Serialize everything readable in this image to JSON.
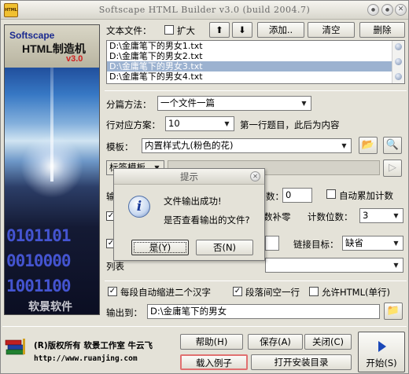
{
  "window": {
    "title": "Softscape HTML Builder v3.0 (build 2004.7)",
    "app_icon": "HTML",
    "min_glyph": "●",
    "max_glyph": "●",
    "close_glyph": "✕"
  },
  "banner": {
    "line1": "Softscape",
    "line2": "HTML制造机",
    "line3": "v3.0",
    "binary": [
      "0101101",
      "0010000",
      "1001100"
    ],
    "brand": "软景软件"
  },
  "files": {
    "label": "文本文件：",
    "expand_label": "扩大",
    "expand_checked": false,
    "up_glyph": "⬆",
    "down_glyph": "⬇",
    "add_label": "添加..",
    "clear_label": "清空",
    "delete_label": "删除",
    "items": [
      "D:\\金庸笔下的男女1.txt",
      "D:\\金庸笔下的男女2.txt",
      "D:\\金庸笔下的男女3.txt",
      "D:\\金庸笔下的男女4.txt"
    ],
    "selected_index": 2
  },
  "split": {
    "label": "分篇方法：",
    "value": "一个文件一篇"
  },
  "row_plan": {
    "label": "行对应方案：",
    "value": "10",
    "note": "第一行题目，此后为内容"
  },
  "template": {
    "label": "模板：",
    "value": "内置样式九(粉色的花)",
    "open_icon": "📂",
    "search_icon": "🔍"
  },
  "tags": {
    "select_value": "标签模板"
  },
  "counters": {
    "partial_label": "数：",
    "value": "0",
    "auto_accum_label": "自动累加计数",
    "auto_accum_checked": false,
    "pad_zero_label": "数补零",
    "digits_label": "计数位数：",
    "digits_value": "3"
  },
  "link_target": {
    "label": "链接目标：",
    "value": "缺省"
  },
  "list_partial": {
    "label": "列表"
  },
  "options": {
    "indent_label": "每段自动缩进二个汉字",
    "indent_checked": true,
    "blank_line_label": "段落间空一行",
    "blank_line_checked": true,
    "allow_html_label": "允许HTML(单行)",
    "allow_html_checked": false
  },
  "output": {
    "label": "输出到：",
    "value": "D:\\金庸笔下的男女"
  },
  "footer": {
    "copyright": "(R)版权所有 软景工作室 牛云飞",
    "url": "http://www.ruanjing.com",
    "help_label": "帮助(H)",
    "save_label": "保存(A)",
    "close_label": "关闭(C)",
    "load_example_label": "载入例子",
    "open_install_label": "打开安装目录",
    "start_label": "开始(S)"
  },
  "dialog": {
    "title": "提示",
    "line1": "文件输出成功!",
    "line2": "是否查看输出的文件?",
    "yes_label": "是(Y)",
    "no_label": "否(N)",
    "icon_glyph": "i"
  },
  "colors": {
    "accent_selection": "#9cb2d0",
    "start_arrow": "#1a48b8",
    "load_example_border": "#e07070"
  }
}
